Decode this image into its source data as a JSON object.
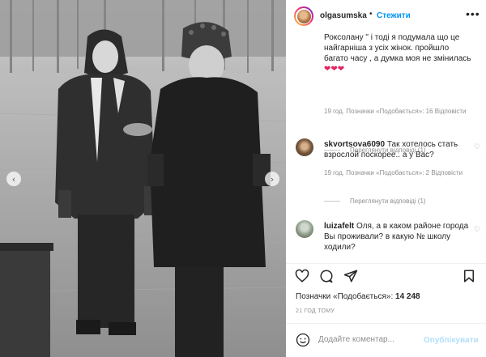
{
  "header": {
    "username": "olgasumska",
    "separator": "•",
    "follow_label": "Стежити",
    "more_icon": "more-horizontal-icon"
  },
  "post_image": {
    "description_icon": "photo",
    "nav_left_icon": "chevron-left-icon",
    "nav_right_icon": "chevron-right-icon"
  },
  "comments": [
    {
      "text": "Роксолану \" і тоді я подумала що це найгарніша з усіх жінок. пройшло багато часу , а думка моя не змінилась",
      "hearts": "❤❤❤",
      "meta": "19 год.   Позначки «Подобається»: 16   Відповісти",
      "view_replies": "Переглянути відповіді (1)"
    },
    {
      "user": "skvortsova6090",
      "text": "Так хотелось стать взрослой поскорее.. а у Вас?",
      "meta": "19 год.   Позначки «Подобається»: 2   Відповісти",
      "view_replies": "Переглянути відповіді (1)"
    },
    {
      "user": "luizafelt",
      "text": "Оля, а в каком районе города Вы проживали? в какую № школу ходили?"
    }
  ],
  "actions": {
    "like_icon": "heart-icon",
    "comment_icon": "comment-icon",
    "share_icon": "send-icon",
    "save_icon": "bookmark-icon"
  },
  "likes": {
    "label": "Позначки «Подобається»:",
    "count": "14 248"
  },
  "time_ago": "21 ГОД ТОМУ",
  "add_comment": {
    "placeholder": "Додайте коментар...",
    "publish_label": "Опублікувати"
  },
  "colors": {
    "accent": "#0095f6",
    "publish_disabled": "#b2dffc",
    "muted": "#8e8e8e",
    "heart": "#e0245e"
  }
}
